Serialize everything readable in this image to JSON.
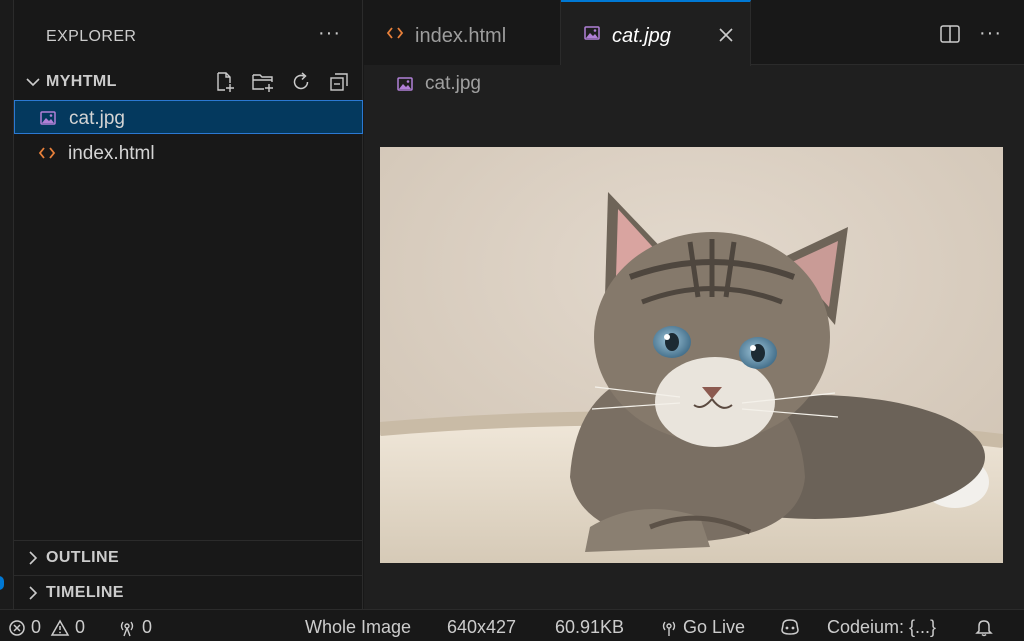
{
  "sidebar": {
    "title": "EXPLORER",
    "more_icon": "ellipsis-icon",
    "folder": {
      "label": "MYHTML",
      "actions": [
        "new-file-icon",
        "new-folder-icon",
        "refresh-icon",
        "collapse-all-icon"
      ]
    },
    "files": [
      {
        "label": "cat.jpg",
        "icon": "image-file-icon",
        "selected": true
      },
      {
        "label": "index.html",
        "icon": "html-file-icon",
        "selected": false
      }
    ],
    "sections": [
      {
        "label": "OUTLINE"
      },
      {
        "label": "TIMELINE"
      }
    ]
  },
  "tabs": [
    {
      "label": "index.html",
      "icon": "html-file-icon",
      "active": false
    },
    {
      "label": "cat.jpg",
      "icon": "image-file-icon",
      "active": true
    }
  ],
  "tab_actions": [
    "split-editor-icon",
    "ellipsis-icon"
  ],
  "breadcrumb": {
    "label": "cat.jpg",
    "icon": "image-file-icon"
  },
  "image": {
    "subject": "tabby kitten lying on a cream cat bed"
  },
  "statusbar": {
    "errors": "0",
    "warnings": "0",
    "ports": "0",
    "zoom_label": "Whole Image",
    "dimensions": "640x427",
    "file_size": "60.91KB",
    "go_live": "Go Live",
    "codeium": "Codeium: {...}"
  },
  "colors": {
    "accent": "#0078d4",
    "selection_bg": "#04395e",
    "html_icon": "#e8803a",
    "image_icon": "#b180d7"
  }
}
